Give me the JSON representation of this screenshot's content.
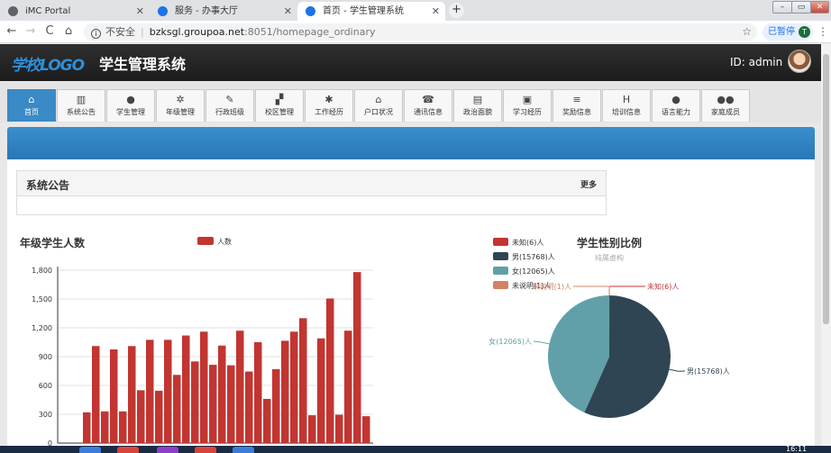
{
  "browser": {
    "tabs": [
      {
        "title": "iMC Portal",
        "icon_color": "#5f6368"
      },
      {
        "title": "服务 - 办事大厅",
        "icon_color": "#1a73e8"
      },
      {
        "title": "首页 - 学生管理系统",
        "icon_color": "#1a73e8"
      }
    ],
    "new_tab_label": "+",
    "window_buttons": [
      "–",
      "▭",
      "✕"
    ],
    "nav": {
      "back": "←",
      "forward": "→",
      "reload": "C",
      "home": "⌂"
    },
    "address": {
      "info_icon": "i",
      "insecure_label": "不安全",
      "separator": "|",
      "host": "bzksgl.groupoa.net",
      "path": ":8051/homepage_ordinary",
      "star": "☆"
    },
    "profile": {
      "label": "已暂停",
      "initial": "T"
    },
    "menu": "⋮"
  },
  "app": {
    "logo_text": "学校LOGO",
    "title": "学生管理系统",
    "user_id": "ID: admin"
  },
  "nav": {
    "items": [
      {
        "label": "首页",
        "icon": "home-icon",
        "glyph": "⌂"
      },
      {
        "label": "系统公告",
        "icon": "chart-icon",
        "glyph": "▥"
      },
      {
        "label": "学生管理",
        "icon": "user-icon",
        "glyph": "●"
      },
      {
        "label": "年级管理",
        "icon": "gear-icon",
        "glyph": "✲"
      },
      {
        "label": "行政班级",
        "icon": "edit-icon",
        "glyph": "✎"
      },
      {
        "label": "校区管理",
        "icon": "puzzle-icon",
        "glyph": "▞"
      },
      {
        "label": "工作经历",
        "icon": "asterisk-icon",
        "glyph": "✱"
      },
      {
        "label": "户口状况",
        "icon": "house-icon",
        "glyph": "⌂"
      },
      {
        "label": "通讯信息",
        "icon": "phone-icon",
        "glyph": "☎"
      },
      {
        "label": "政治面貌",
        "icon": "file-icon",
        "glyph": "▤"
      },
      {
        "label": "学习经历",
        "icon": "briefcase-icon",
        "glyph": "▣"
      },
      {
        "label": "奖励信息",
        "icon": "list-icon",
        "glyph": "≡"
      },
      {
        "label": "培训信息",
        "icon": "h-square-icon",
        "glyph": "H"
      },
      {
        "label": "语言能力",
        "icon": "comment-icon",
        "glyph": "●"
      },
      {
        "label": "家庭成员",
        "icon": "users-icon",
        "glyph": "●●"
      }
    ]
  },
  "notice": {
    "title": "系统公告",
    "more_label": "更多"
  },
  "colors": {
    "bar": "#c23531",
    "male": "#2f4554",
    "female": "#61a0a8",
    "unknown": "#c23531",
    "unexplained": "#d48265"
  },
  "chart_data": [
    {
      "type": "bar",
      "title": "年级学生人数",
      "legend": [
        "人数"
      ],
      "legend_position": "top",
      "ylim": [
        0,
        1800
      ],
      "yticks": [
        "0",
        "300",
        "600",
        "900",
        "1,200",
        "1,500",
        "1,800"
      ],
      "yticks_values": [
        0,
        300,
        600,
        900,
        1200,
        1500,
        1800
      ],
      "grid": true,
      "series": [
        {
          "name": "人数",
          "values": [
            320,
            1010,
            330,
            975,
            330,
            1010,
            550,
            1075,
            545,
            1075,
            710,
            1120,
            850,
            1160,
            815,
            1015,
            810,
            1170,
            745,
            1050,
            460,
            770,
            1065,
            1160,
            1300,
            290,
            1090,
            1505,
            295,
            1170,
            1780,
            280
          ]
        }
      ]
    },
    {
      "type": "pie",
      "title": "学生性别比例",
      "subtitle": "纯属虚构",
      "legend_position": "top-left",
      "slices": [
        {
          "name": "未知",
          "value": 6,
          "legend": "未知(6)人",
          "label": "未知(6)人"
        },
        {
          "name": "男",
          "value": 15768,
          "legend": "男(15768)人",
          "label": "男(15768)人"
        },
        {
          "name": "女",
          "value": 12065,
          "legend": "女(12065)人",
          "label": "女(12065)人"
        },
        {
          "name": "未说明",
          "value": 1,
          "legend": "未说明(1)人",
          "label": "未说明(1)人"
        }
      ]
    }
  ],
  "taskbar": {
    "clock": "16:11"
  }
}
